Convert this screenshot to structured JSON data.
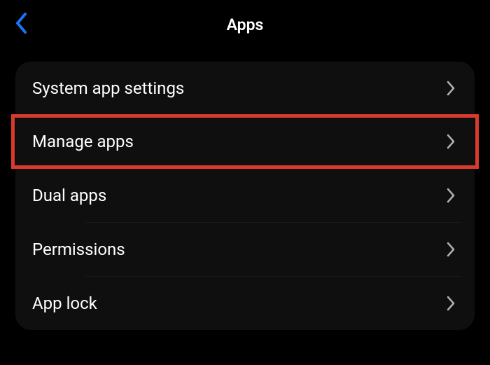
{
  "header": {
    "title": "Apps"
  },
  "list": {
    "items": [
      {
        "label": "System app settings",
        "highlighted": false
      },
      {
        "label": "Manage apps",
        "highlighted": true
      },
      {
        "label": "Dual apps",
        "highlighted": false
      },
      {
        "label": "Permissions",
        "highlighted": false
      },
      {
        "label": "App lock",
        "highlighted": false
      }
    ]
  },
  "colors": {
    "back_icon": "#1b74f8",
    "chevron": "#b0b0b0",
    "highlight": "#d83a2e"
  }
}
